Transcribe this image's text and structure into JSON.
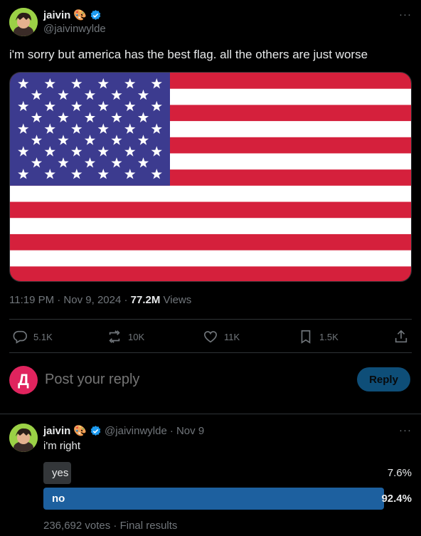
{
  "tweet": {
    "author_name": "jaivin",
    "author_emoji": "🎨",
    "author_handle": "@jaivinwylde",
    "text": "i'm sorry but america has the best flag. all the others are just worse",
    "time": "11:19 PM · Nov 9, 2024 · ",
    "views_count": "77.2M",
    "views_label": " Views",
    "more": "···"
  },
  "actions": {
    "replies": "5.1K",
    "reposts": "10K",
    "likes": "11K",
    "bookmarks": "1.5K"
  },
  "composer": {
    "avatar_letter": "Д",
    "avatar_color": "#e0245e",
    "placeholder": "Post your reply",
    "button": "Reply"
  },
  "reply": {
    "author_name": "jaivin",
    "author_emoji": "🎨",
    "author_handle": "@jaivinwylde",
    "date": " · Nov 9",
    "text": "i'm right",
    "more": "···",
    "poll": {
      "options": [
        {
          "label": "yes",
          "percent_label": "7.6%",
          "fraction": 0.076
        },
        {
          "label": "no",
          "percent_label": "92.4%",
          "fraction": 0.924
        }
      ],
      "footer": "236,692 votes · Final results"
    }
  },
  "colors": {
    "accent": "#1d9bf0",
    "verified": "#1d9bf0",
    "poll_winner": "#1d609f",
    "poll_other": "#333639"
  }
}
